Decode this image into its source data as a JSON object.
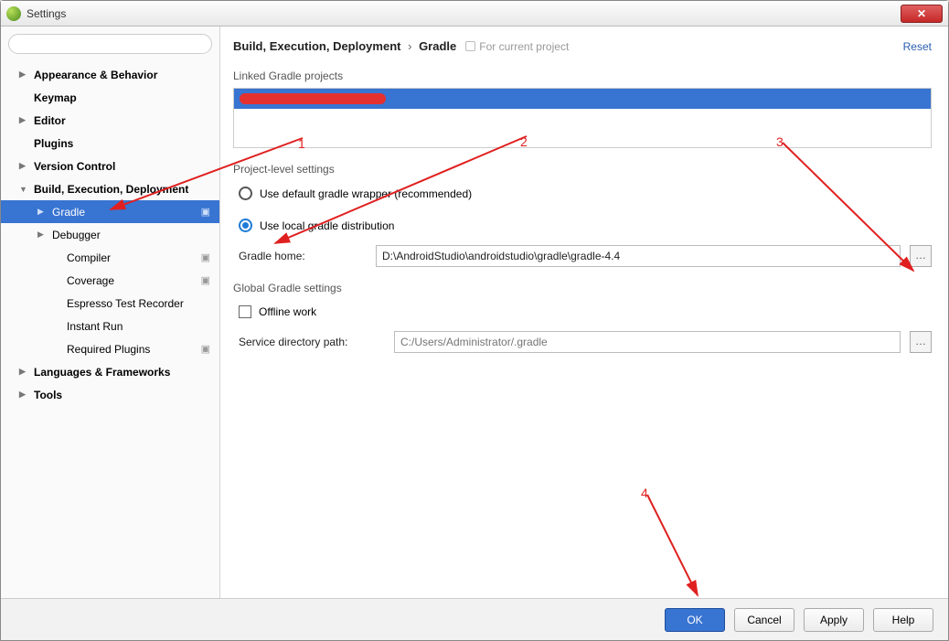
{
  "window": {
    "title": "Settings"
  },
  "sidebar": {
    "search_placeholder": "",
    "items": [
      {
        "label": "Appearance & Behavior",
        "bold": true,
        "arrow": "▶"
      },
      {
        "label": "Keymap",
        "bold": true,
        "arrow": ""
      },
      {
        "label": "Editor",
        "bold": true,
        "arrow": "▶"
      },
      {
        "label": "Plugins",
        "bold": true,
        "arrow": ""
      },
      {
        "label": "Version Control",
        "bold": true,
        "arrow": "▶"
      },
      {
        "label": "Build, Execution, Deployment",
        "bold": true,
        "arrow": "▼"
      },
      {
        "label": "Gradle",
        "bold": false,
        "arrow": "▶",
        "selected": true,
        "trail": true,
        "class": "child"
      },
      {
        "label": "Debugger",
        "bold": false,
        "arrow": "▶",
        "class": "child"
      },
      {
        "label": "Compiler",
        "bold": false,
        "arrow": "",
        "class": "grandchild",
        "trail": true
      },
      {
        "label": "Coverage",
        "bold": false,
        "arrow": "",
        "class": "grandchild",
        "trail": true
      },
      {
        "label": "Espresso Test Recorder",
        "bold": false,
        "arrow": "",
        "class": "grandchild"
      },
      {
        "label": "Instant Run",
        "bold": false,
        "arrow": "",
        "class": "grandchild"
      },
      {
        "label": "Required Plugins",
        "bold": false,
        "arrow": "",
        "class": "grandchild",
        "trail": true
      },
      {
        "label": "Languages & Frameworks",
        "bold": true,
        "arrow": "▶"
      },
      {
        "label": "Tools",
        "bold": true,
        "arrow": "▶"
      }
    ]
  },
  "breadcrumb": {
    "part1": "Build, Execution, Deployment",
    "part2": "Gradle"
  },
  "hint": "For current project",
  "reset_label": "Reset",
  "sections": {
    "linked_label": "Linked Gradle projects",
    "project_level_label": "Project-level settings",
    "global_label": "Global Gradle settings"
  },
  "options": {
    "default_wrapper": "Use default gradle wrapper (recommended)",
    "local_dist": "Use local gradle distribution"
  },
  "fields": {
    "gradle_home_label": "Gradle home:",
    "gradle_home_value": "D:\\AndroidStudio\\androidstudio\\gradle\\gradle-4.4",
    "offline_label": "Offline work",
    "service_dir_label": "Service directory path:",
    "service_dir_placeholder": "C:/Users/Administrator/.gradle"
  },
  "buttons": {
    "ok": "OK",
    "cancel": "Cancel",
    "apply": "Apply",
    "help": "Help"
  },
  "annotations": {
    "n1": "1",
    "n2": "2",
    "n3": "3",
    "n4": "4"
  }
}
